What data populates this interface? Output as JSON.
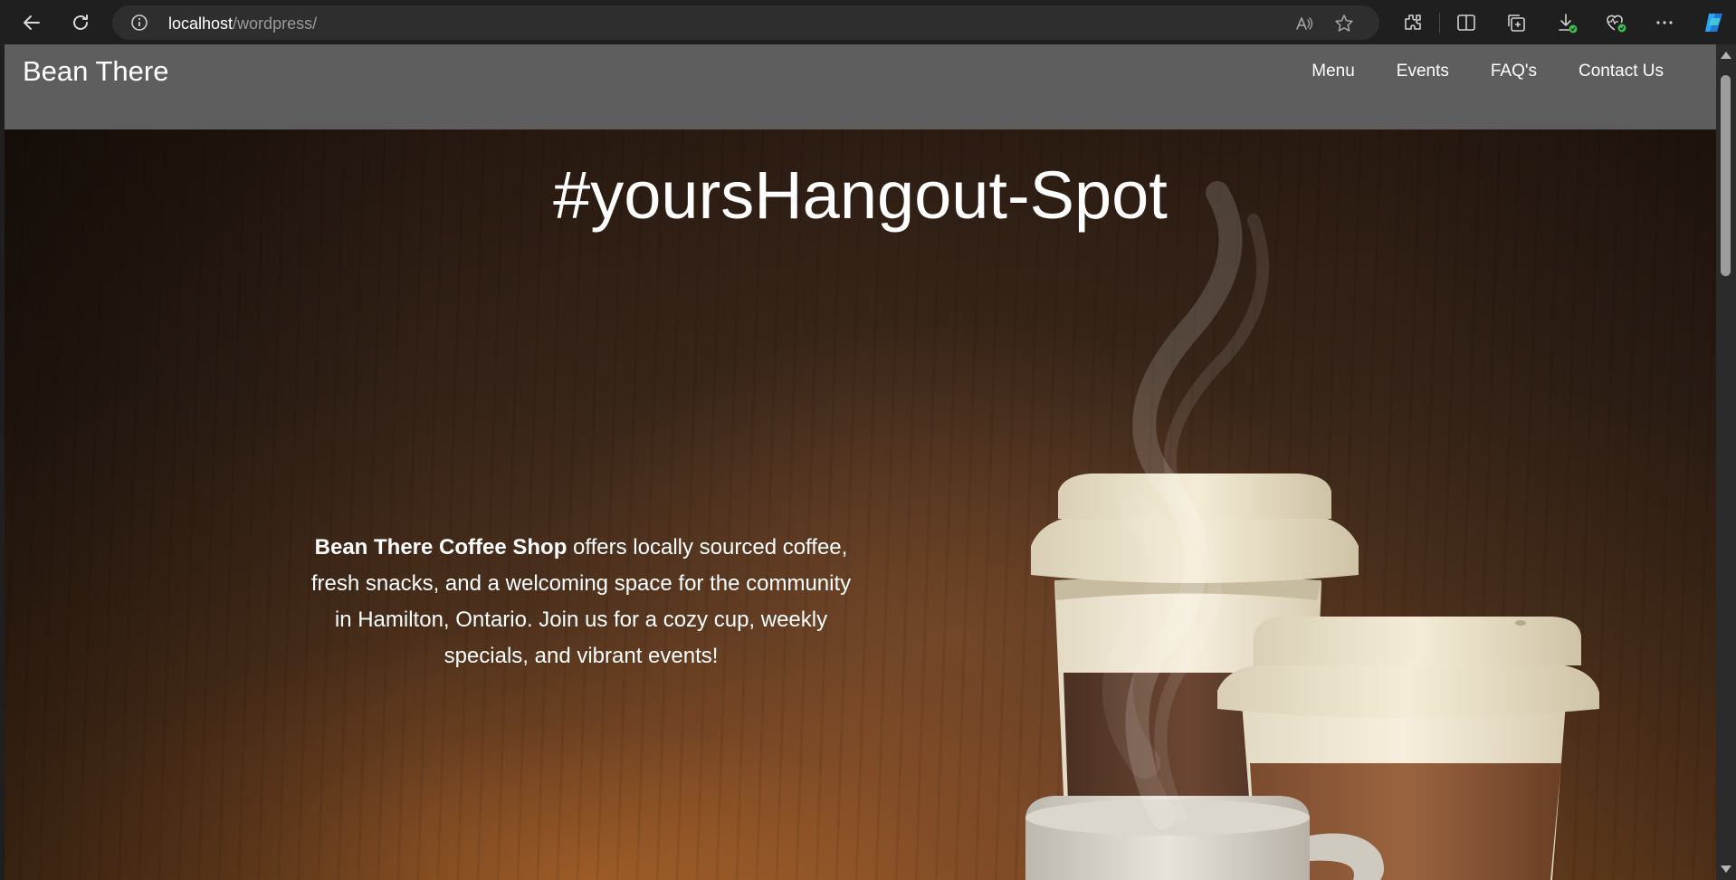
{
  "browser": {
    "url_host": "localhost",
    "url_path": "/wordpress/"
  },
  "site": {
    "title": "Bean There",
    "nav": [
      {
        "label": "Menu"
      },
      {
        "label": "Events"
      },
      {
        "label": "FAQ's"
      },
      {
        "label": "Contact Us"
      }
    ]
  },
  "hero": {
    "heading": "#yoursHangout-Spot",
    "intro_bold": "Bean There Coffee Shop",
    "intro_rest": " offers locally sourced coffee, fresh snacks, and a welcoming space for the community in Hamilton, Ontario. Join us for a cozy cup, weekly specials, and vibrant events!"
  },
  "colors": {
    "header_bg": "#5e5e5e",
    "browser_bg": "#1f1f1f",
    "hero_dark": "#2c1c12",
    "hero_warm": "#7a4a24"
  }
}
